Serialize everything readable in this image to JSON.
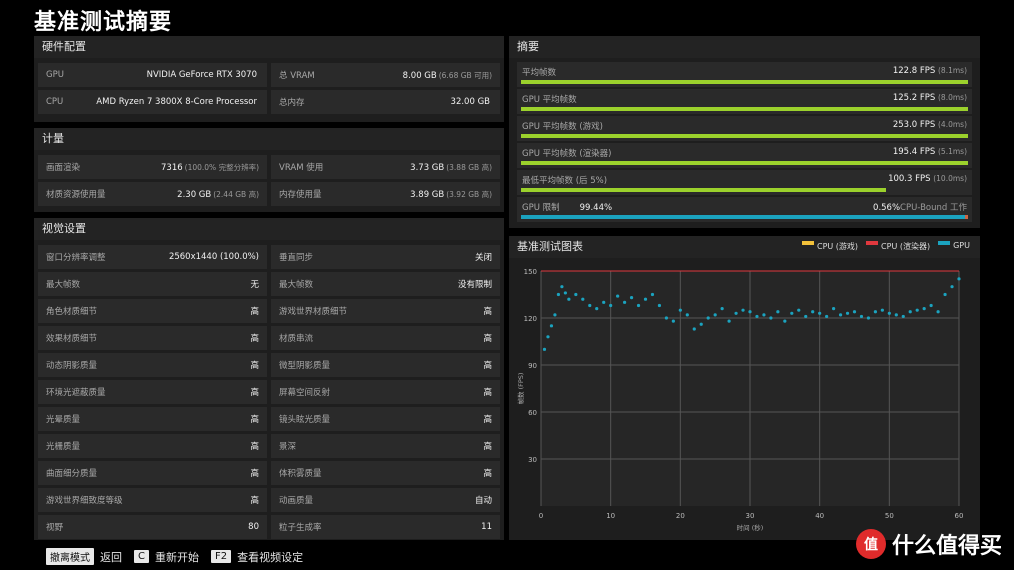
{
  "page_title": "基准测试摘要",
  "hardware": {
    "heading": "硬件配置",
    "rows": [
      {
        "k1": "GPU",
        "v1": "NVIDIA GeForce RTX 3070",
        "n1": "",
        "k2": "总 VRAM",
        "v2": "8.00 GB",
        "n2": "(6.68 GB 可用)"
      },
      {
        "k1": "CPU",
        "v1": "AMD Ryzen 7 3800X 8-Core Processor",
        "n1": "",
        "k2": "总内存",
        "v2": "32.00 GB",
        "n2": ""
      }
    ]
  },
  "metrics": {
    "heading": "计量",
    "rows": [
      {
        "k1": "画面渲染",
        "v1": "7316",
        "n1": "(100.0% 完整分辨率)",
        "k2": "VRAM 使用",
        "v2": "3.73 GB",
        "n2": "(3.88 GB 高)"
      },
      {
        "k1": "材质资源使用量",
        "v1": "2.30 GB",
        "n1": "(2.44 GB 高)",
        "k2": "内存使用量",
        "v2": "3.89 GB",
        "n2": "(3.92 GB 高)"
      }
    ]
  },
  "visual": {
    "heading": "视觉设置",
    "rows": [
      {
        "k1": "窗口分辨率调整",
        "v1": "2560x1440 (100.0%)",
        "k2": "垂直同步",
        "v2": "关闭"
      },
      {
        "k1": "最大帧数",
        "v1": "无",
        "k2": "最大帧数",
        "v2": "没有限制"
      },
      {
        "k1": "角色材质细节",
        "v1": "高",
        "k2": "游戏世界材质细节",
        "v2": "高"
      },
      {
        "k1": "效果材质细节",
        "v1": "高",
        "k2": "材质串流",
        "v2": "高"
      },
      {
        "k1": "动态阴影质量",
        "v1": "高",
        "k2": "微型阴影质量",
        "v2": "高"
      },
      {
        "k1": "环境光遮蔽质量",
        "v1": "高",
        "k2": "屏幕空间反射",
        "v2": "高"
      },
      {
        "k1": "光晕质量",
        "v1": "高",
        "k2": "镜头眩光质量",
        "v2": "高"
      },
      {
        "k1": "光栅质量",
        "v1": "高",
        "k2": "景深",
        "v2": "高"
      },
      {
        "k1": "曲面细分质量",
        "v1": "高",
        "k2": "体积雾质量",
        "v2": "高"
      },
      {
        "k1": "游戏世界细致度等级",
        "v1": "高",
        "k2": "动画质量",
        "v2": "自动"
      },
      {
        "k1": "视野",
        "v1": "80",
        "k2": "粒子生成率",
        "v2": "11"
      }
    ]
  },
  "summary": {
    "heading": "摘要",
    "rows": [
      {
        "label": "平均帧数",
        "value": "122.8 FPS",
        "note": "(8.1ms)",
        "fill": 1.0
      },
      {
        "label": "GPU 平均帧数",
        "value": "125.2 FPS",
        "note": "(8.0ms)",
        "fill": 1.0
      },
      {
        "label": "GPU 平均帧数 (游戏)",
        "value": "253.0 FPS",
        "note": "(4.0ms)",
        "fill": 1.0
      },
      {
        "label": "GPU 平均帧数 (渲染器)",
        "value": "195.4 FPS",
        "note": "(5.1ms)",
        "fill": 1.0
      },
      {
        "label": "最低平均帧数 (后 5%)",
        "value": "100.3 FPS",
        "note": "(10.0ms)",
        "fill": 0.82
      }
    ],
    "gpu_limit": {
      "label": "GPU 限制",
      "left_value": "99.44%",
      "right_value": "0.56%",
      "right_label": "CPU-Bound 工作",
      "fill": 0.9944
    },
    "colors": {
      "bar": "#9bd12c",
      "gpu": "#1ba3bf",
      "cpu": "#f3c13a",
      "render": "#e0383e"
    }
  },
  "chart_data": {
    "type": "scatter",
    "title": "基准测试图表",
    "xlabel": "时间 (秒)",
    "ylabel": "帧数 (FPS)",
    "xlim": [
      0,
      60
    ],
    "ylim": [
      0,
      150
    ],
    "xticks": [
      "0",
      "10",
      "20",
      "30",
      "40",
      "50",
      "60"
    ],
    "yticks": [
      "30",
      "60",
      "90",
      "120",
      "150"
    ],
    "legend_position": "top-right",
    "grid": true,
    "series": [
      {
        "name": "CPU (游戏)",
        "color": "#f3c13a",
        "x": [],
        "y": []
      },
      {
        "name": "CPU (渲染器)",
        "color": "#e0383e",
        "x": [
          0,
          60
        ],
        "y": [
          150,
          150
        ]
      },
      {
        "name": "GPU",
        "color": "#1ba3bf",
        "x": [
          0.5,
          1,
          1.5,
          2,
          2.5,
          3,
          3.5,
          4,
          5,
          6,
          7,
          8,
          9,
          10,
          11,
          12,
          13,
          14,
          15,
          16,
          17,
          18,
          19,
          20,
          21,
          22,
          23,
          24,
          25,
          26,
          27,
          28,
          29,
          30,
          31,
          32,
          33,
          34,
          35,
          36,
          37,
          38,
          39,
          40,
          41,
          42,
          43,
          44,
          45,
          46,
          47,
          48,
          49,
          50,
          51,
          52,
          53,
          54,
          55,
          56,
          57,
          58,
          59,
          60
        ],
        "y": [
          100,
          108,
          115,
          122,
          135,
          140,
          136,
          132,
          135,
          132,
          128,
          126,
          130,
          128,
          134,
          130,
          133,
          128,
          132,
          135,
          128,
          120,
          118,
          125,
          122,
          113,
          116,
          120,
          122,
          126,
          118,
          123,
          125,
          124,
          121,
          122,
          120,
          124,
          118,
          123,
          125,
          121,
          124,
          123,
          121,
          126,
          122,
          123,
          124,
          121,
          120,
          124,
          125,
          123,
          122,
          121,
          124,
          125,
          126,
          128,
          124,
          135,
          140,
          145
        ]
      }
    ]
  },
  "footer": {
    "hints": [
      {
        "key": "撤离模式",
        "label": "返回"
      },
      {
        "key": "C",
        "label": "重新开始"
      },
      {
        "key": "F2",
        "label": "查看视频设定"
      }
    ],
    "watermark_badge": "值",
    "watermark_text": "什么值得买"
  }
}
